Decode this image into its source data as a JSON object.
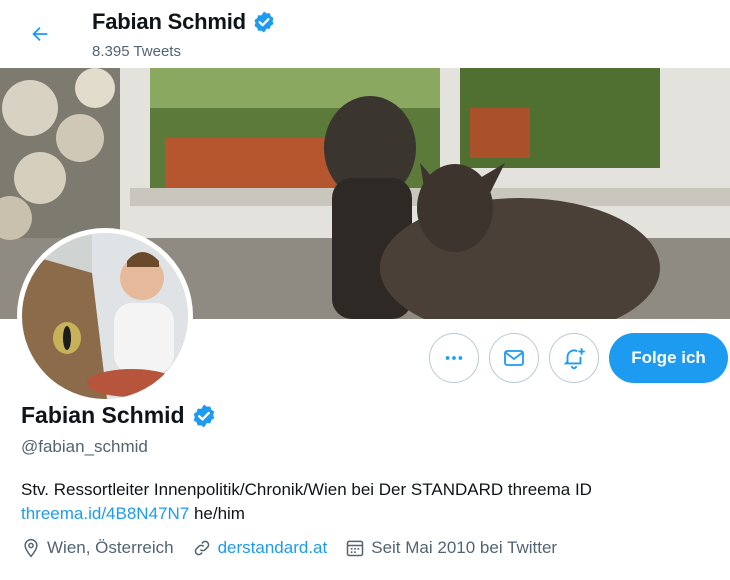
{
  "header": {
    "name": "Fabian Schmid",
    "tweet_count": "8.395 Tweets"
  },
  "profile": {
    "name": "Fabian Schmid",
    "handle": "@fabian_schmid",
    "bio_text": "Stv. Ressortleiter Innenpolitik/Chronik/Wien bei Der STANDARD threema ID",
    "bio_link": "threema.id/4B8N47N7",
    "bio_suffix": " he/him",
    "location": "Wien, Österreich",
    "website": "derstandard.at",
    "joined": "Seit Mai 2010 bei Twitter"
  },
  "actions": {
    "follow_label": "Folge ich"
  },
  "colors": {
    "accent": "#1d9bf0",
    "text": "#0f1419",
    "muted": "#536471"
  },
  "icons": [
    "back-arrow-icon",
    "verified-badge-icon",
    "more-icon",
    "mail-icon",
    "notification-bell-icon",
    "location-icon",
    "link-icon",
    "calendar-icon"
  ]
}
